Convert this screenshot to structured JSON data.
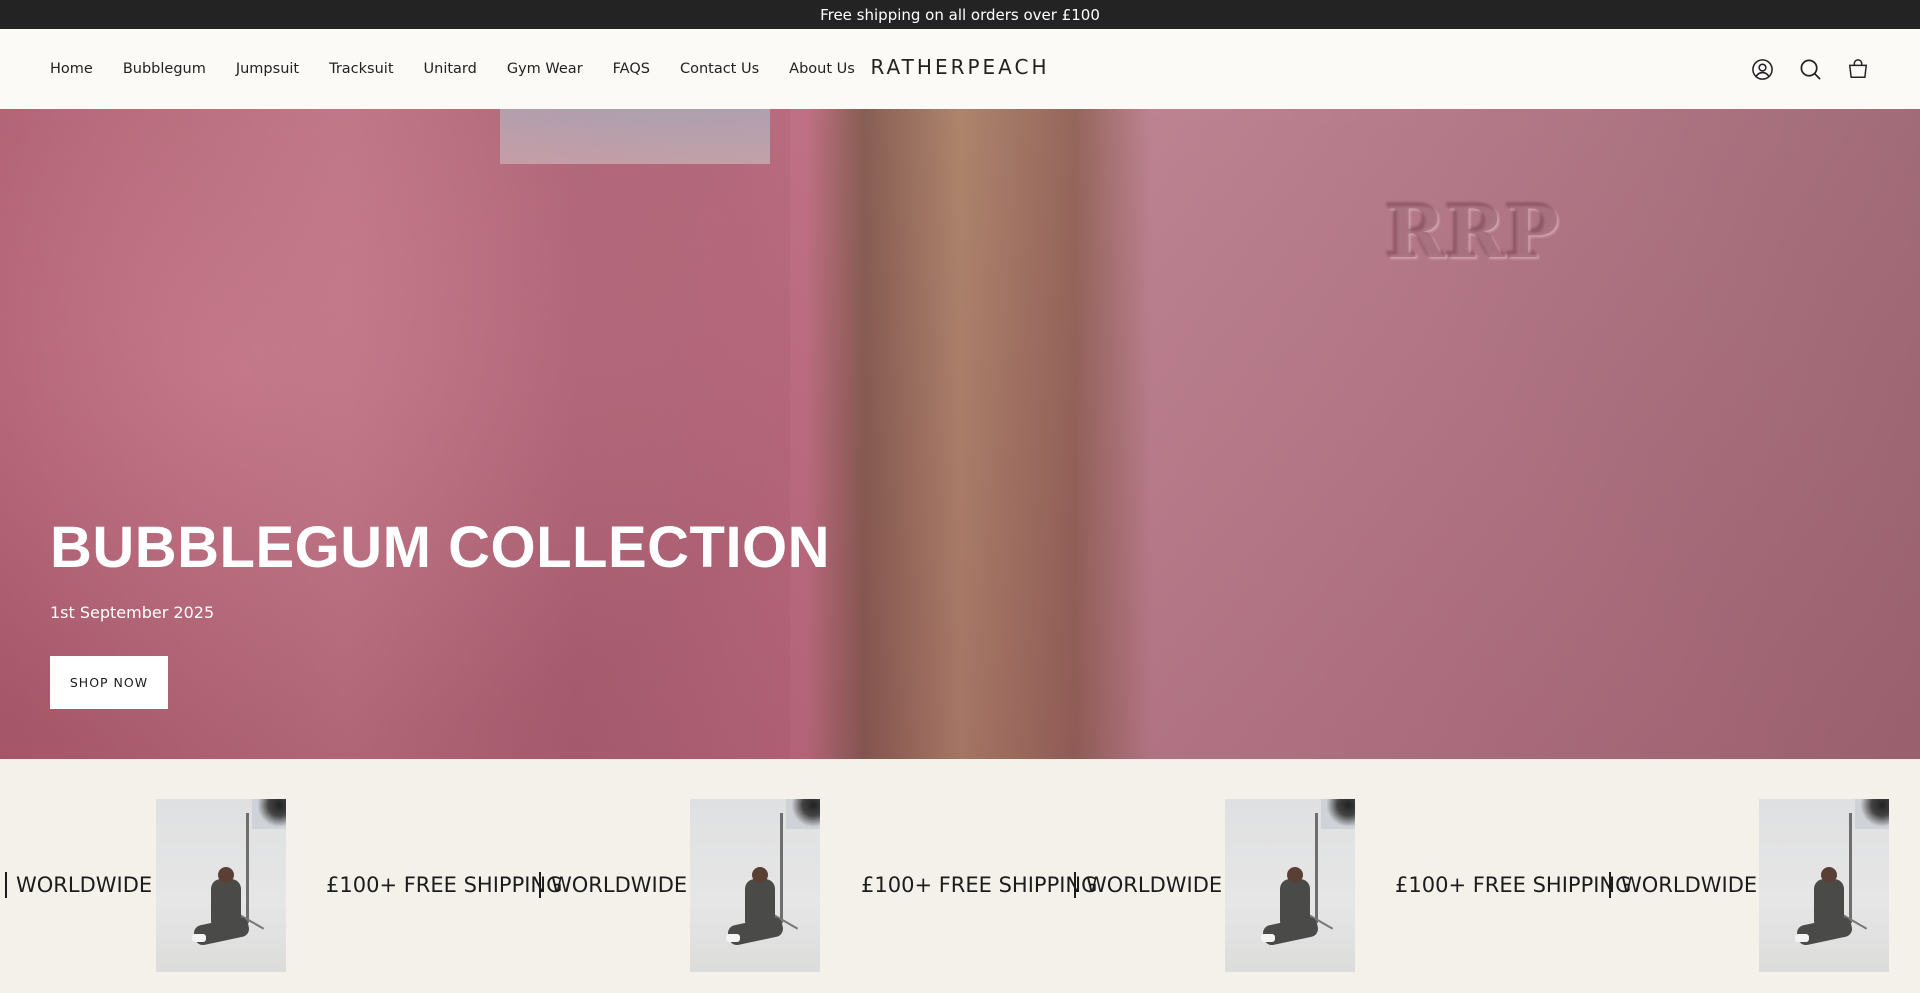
{
  "announcement": "Free shipping on all orders over £100",
  "nav": [
    "Home",
    "Bubblegum",
    "Jumpsuit",
    "Tracksuit",
    "Unitard",
    "Gym Wear",
    "FAQS",
    "Contact Us",
    "About Us"
  ],
  "logo": "RATHERPEACH",
  "header_icons": [
    "account-icon",
    "search-icon",
    "cart-icon"
  ],
  "hero": {
    "emboss": "RRP",
    "title": "BUBBLEGUM COLLECTION",
    "date": "1st September 2025",
    "button": "SHOP NOW"
  },
  "marquee": {
    "worldwide": "WORLDWIDE",
    "shipping": "£100+ FREE SHIPPING"
  },
  "colors": {
    "announcement_bg": "#232323",
    "header_bg": "#fbfaf7",
    "marquee_bg": "#f4f1ea",
    "hero_pink": "#c97f8e"
  }
}
